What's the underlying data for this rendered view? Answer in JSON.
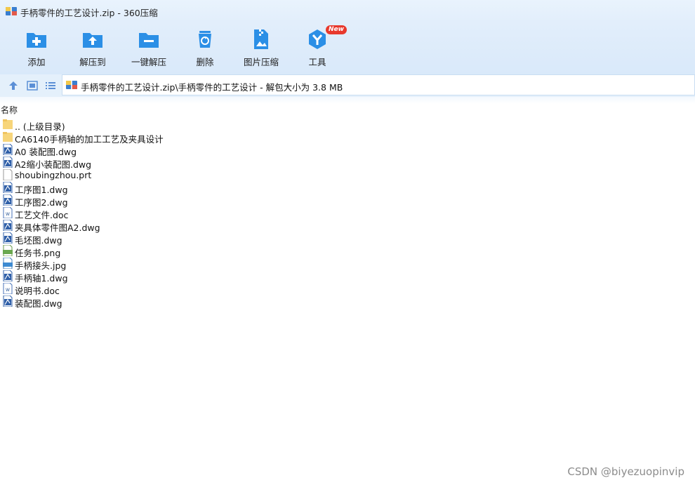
{
  "window": {
    "title": "手柄零件的工艺设计.zip - 360压缩"
  },
  "toolbar": {
    "add": "添加",
    "extract_to": "解压到",
    "one_click_extract": "一键解压",
    "delete": "删除",
    "image_compress": "图片压缩",
    "tools": "工具",
    "new_badge": "New"
  },
  "address": {
    "path": "手柄零件的工艺设计.zip\\手柄零件的工艺设计 - 解包大小为 3.8 MB"
  },
  "list": {
    "column_name": "名称",
    "items": [
      {
        "name": ".. (上级目录)",
        "type": "folder"
      },
      {
        "name": "CA6140手柄轴的加工工艺及夹具设计",
        "type": "folder"
      },
      {
        "name": "A0 装配图.dwg",
        "type": "dwg"
      },
      {
        "name": "A2缩小装配图.dwg",
        "type": "dwg"
      },
      {
        "name": "shoubingzhou.prt",
        "type": "blank"
      },
      {
        "name": "工序图1.dwg",
        "type": "dwg"
      },
      {
        "name": "工序图2.dwg",
        "type": "dwg"
      },
      {
        "name": "工艺文件.doc",
        "type": "doc"
      },
      {
        "name": "夹具体零件图A2.dwg",
        "type": "dwg"
      },
      {
        "name": "毛坯图.dwg",
        "type": "dwg"
      },
      {
        "name": "任务书.png",
        "type": "png"
      },
      {
        "name": "手柄接头.jpg",
        "type": "jpg"
      },
      {
        "name": "手柄轴1.dwg",
        "type": "dwg"
      },
      {
        "name": "说明书.doc",
        "type": "doc"
      },
      {
        "name": "装配图.dwg",
        "type": "dwg"
      }
    ]
  },
  "watermark": "CSDN @biyezuopinvip",
  "colors": {
    "accent": "#2b8fe6",
    "title_bg": "#e2eefb",
    "folder": "#f7d57a"
  }
}
